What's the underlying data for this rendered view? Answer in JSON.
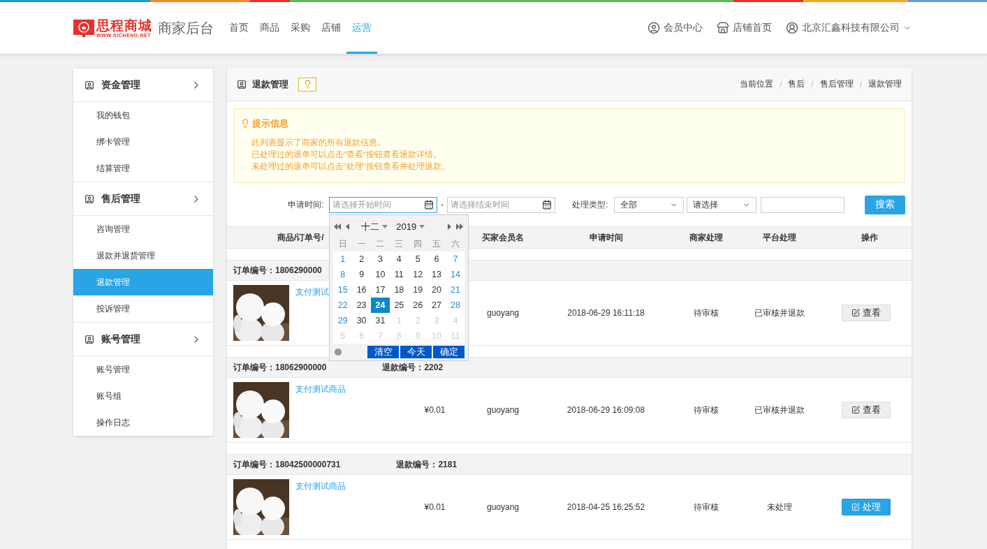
{
  "header": {
    "logo_title": "思程商城",
    "logo_url": "WWW.SICHENG.NET",
    "app_name": "商家后台",
    "nav": [
      {
        "label": "首页",
        "selected": false
      },
      {
        "label": "商品",
        "selected": false
      },
      {
        "label": "采购",
        "selected": false
      },
      {
        "label": "店铺",
        "selected": false
      },
      {
        "label": "运营",
        "selected": true
      }
    ],
    "links": [
      {
        "label": "会员中心",
        "kind": "member"
      },
      {
        "label": "店铺首页",
        "kind": "shop"
      },
      {
        "label": "北京汇鑫科技有限公司",
        "kind": "account"
      }
    ]
  },
  "sidebar": [
    {
      "title": "资金管理",
      "items": [
        {
          "label": "我的钱包",
          "selected": false
        },
        {
          "label": "绑卡管理",
          "selected": false
        },
        {
          "label": "结算管理",
          "selected": false
        }
      ]
    },
    {
      "title": "售后管理",
      "items": [
        {
          "label": "咨询管理",
          "selected": false
        },
        {
          "label": "退款并退货管理",
          "selected": false
        },
        {
          "label": "退款管理",
          "selected": true
        },
        {
          "label": "投诉管理",
          "selected": false
        }
      ]
    },
    {
      "title": "账号管理",
      "items": [
        {
          "label": "账号管理",
          "selected": false
        },
        {
          "label": "账号组",
          "selected": false
        },
        {
          "label": "操作日志",
          "selected": false
        }
      ]
    }
  ],
  "panel": {
    "title": "退款管理",
    "breadcrumb": [
      "当前位置",
      "售后",
      "售后管理",
      "退款管理"
    ],
    "breadcrumb_separator": "/",
    "tip": {
      "title": "提示信息",
      "lines": [
        "此列表显示了商家的所有退款信息。",
        "已处理过的退单可以点击\"查看\"按钮查看退款详情。",
        "未处理过的退单可以点击\"处理\"按钮查看并处理退款。"
      ]
    },
    "filters": {
      "time_label": "申请时间:",
      "start_placeholder": "请选择开始时间",
      "separator": "-",
      "end_placeholder": "请选择结束时间",
      "type_label": "处理类型:",
      "type_value": "全部",
      "second_value": "请选择",
      "search_button": "搜索"
    },
    "calendar": {
      "month": "十二",
      "year": "2019",
      "weekdays": [
        "日",
        "一",
        "二",
        "三",
        "四",
        "五",
        "六"
      ],
      "days": [
        {
          "label": "1",
          "in_month": true,
          "selected": false
        },
        {
          "label": "2",
          "in_month": true,
          "selected": false
        },
        {
          "label": "3",
          "in_month": true,
          "selected": false
        },
        {
          "label": "4",
          "in_month": true,
          "selected": false
        },
        {
          "label": "5",
          "in_month": true,
          "selected": false
        },
        {
          "label": "6",
          "in_month": true,
          "selected": false
        },
        {
          "label": "7",
          "in_month": true,
          "selected": false
        },
        {
          "label": "8",
          "in_month": true,
          "selected": false
        },
        {
          "label": "9",
          "in_month": true,
          "selected": false
        },
        {
          "label": "10",
          "in_month": true,
          "selected": false
        },
        {
          "label": "11",
          "in_month": true,
          "selected": false
        },
        {
          "label": "12",
          "in_month": true,
          "selected": false
        },
        {
          "label": "13",
          "in_month": true,
          "selected": false
        },
        {
          "label": "14",
          "in_month": true,
          "selected": false
        },
        {
          "label": "15",
          "in_month": true,
          "selected": false
        },
        {
          "label": "16",
          "in_month": true,
          "selected": false
        },
        {
          "label": "17",
          "in_month": true,
          "selected": false
        },
        {
          "label": "18",
          "in_month": true,
          "selected": false
        },
        {
          "label": "19",
          "in_month": true,
          "selected": false
        },
        {
          "label": "20",
          "in_month": true,
          "selected": false
        },
        {
          "label": "21",
          "in_month": true,
          "selected": false
        },
        {
          "label": "22",
          "in_month": true,
          "selected": false
        },
        {
          "label": "23",
          "in_month": true,
          "selected": false
        },
        {
          "label": "24",
          "in_month": true,
          "selected": true
        },
        {
          "label": "25",
          "in_month": true,
          "selected": false
        },
        {
          "label": "26",
          "in_month": true,
          "selected": false
        },
        {
          "label": "27",
          "in_month": true,
          "selected": false
        },
        {
          "label": "28",
          "in_month": true,
          "selected": false
        },
        {
          "label": "29",
          "in_month": true,
          "selected": false
        },
        {
          "label": "30",
          "in_month": true,
          "selected": false
        },
        {
          "label": "31",
          "in_month": true,
          "selected": false
        },
        {
          "label": "1",
          "in_month": false,
          "selected": false
        },
        {
          "label": "2",
          "in_month": false,
          "selected": false
        },
        {
          "label": "3",
          "in_month": false,
          "selected": false
        },
        {
          "label": "4",
          "in_month": false,
          "selected": false
        },
        {
          "label": "5",
          "in_month": false,
          "selected": false
        },
        {
          "label": "6",
          "in_month": false,
          "selected": false
        },
        {
          "label": "7",
          "in_month": false,
          "selected": false
        },
        {
          "label": "8",
          "in_month": false,
          "selected": false
        },
        {
          "label": "9",
          "in_month": false,
          "selected": false
        },
        {
          "label": "10",
          "in_month": false,
          "selected": false
        },
        {
          "label": "11",
          "in_month": false,
          "selected": false
        }
      ],
      "buttons": [
        "清空",
        "今天",
        "确定"
      ]
    },
    "table": {
      "columns": [
        "商品/订单号/",
        "买家会员名",
        "申请时间",
        "商家处理",
        "平台处理",
        "操作"
      ],
      "rows": [
        {
          "order_no": "订单编号：1806290000",
          "product": "支付测试",
          "buyer": "guoyang",
          "time": "2018-06-29 16:11:18",
          "merchant_status": "待审核",
          "platform_status": "已审核并退款",
          "action": {
            "label": "查看",
            "kind": "view"
          }
        },
        {
          "order_no": "订单编号：18062900000",
          "refund_no": "退款编号：2202",
          "product": "支付测试商品",
          "price": "¥0.01",
          "buyer": "guoyang",
          "time": "2018-06-29 16:09:08",
          "merchant_status": "待审核",
          "platform_status": "已审核并退款",
          "action": {
            "label": "查看",
            "kind": "view"
          }
        },
        {
          "order_no": "订单编号：18042500000731",
          "refund_no": "退款编号：2181",
          "product": "支付测试商品",
          "price": "¥0.01",
          "buyer": "guoyang",
          "time": "2018-04-25 16:25:52",
          "merchant_status": "待审核",
          "platform_status": "未处理",
          "action": {
            "label": "处理",
            "kind": "process"
          }
        }
      ]
    }
  }
}
